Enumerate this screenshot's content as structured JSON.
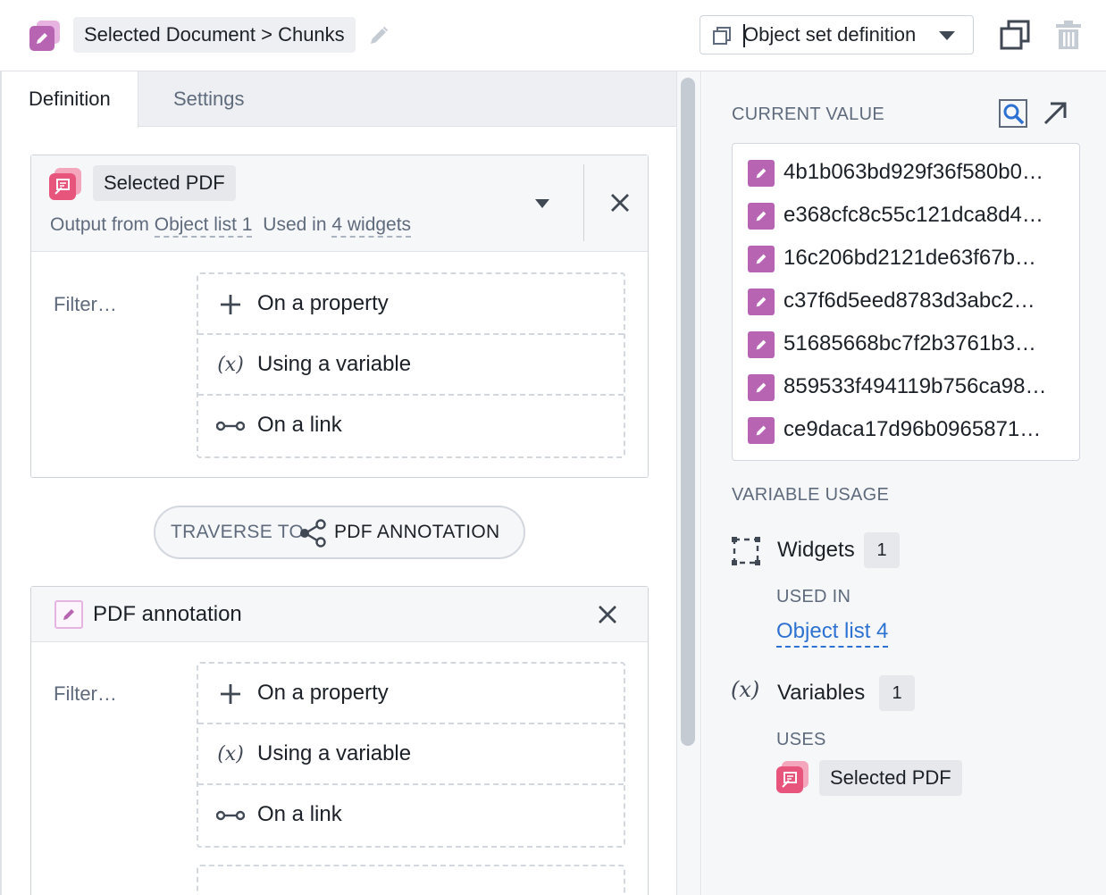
{
  "header": {
    "title": "Selected Document > Chunks",
    "object_set_select": "Object set definition",
    "icons": [
      "pencil-icon",
      "edit-icon",
      "object-set-icon",
      "chevron-down-icon",
      "duplicate-icon",
      "trash-icon"
    ]
  },
  "tabs": [
    {
      "label": "Definition",
      "active": true
    },
    {
      "label": "Settings",
      "active": false
    }
  ],
  "block1": {
    "name": "Selected PDF",
    "output_from_label": "Output from",
    "output_from_link": "Object list 1",
    "used_in_label": "Used in",
    "used_in_link": "4 widgets",
    "filter_label": "Filter…",
    "filters": [
      "On a property",
      "Using a variable",
      "On a link"
    ]
  },
  "traverse": {
    "prefix": "TRAVERSE TO",
    "target": "PDF ANNOTATION"
  },
  "block2": {
    "name": "PDF annotation",
    "filter_label": "Filter…",
    "filters": [
      "On a property",
      "Using a variable",
      "On a link"
    ]
  },
  "right": {
    "current_value_label": "CURRENT VALUE",
    "values": [
      "4b1b063bd929f36f580b0…",
      "e368cfc8c55c121dca8d4…",
      "16c206bd2121de63f67b…",
      "c37f6d5eed8783d3abc2…",
      "51685668bc7f2b3761b3…",
      "859533f494119b756ca98…",
      "ce9daca17d96b0965871…"
    ],
    "variable_usage_label": "VARIABLE USAGE",
    "widgets_label": "Widgets",
    "widgets_count": "1",
    "used_in_label": "USED IN",
    "used_in_link": "Object list 4",
    "variables_label": "Variables",
    "variables_count": "1",
    "uses_label": "USES",
    "uses_item": "Selected PDF"
  },
  "colors": {
    "accent_purple": "#b765b3",
    "accent_pink": "#e7557d",
    "link_blue": "#2d72d2"
  }
}
